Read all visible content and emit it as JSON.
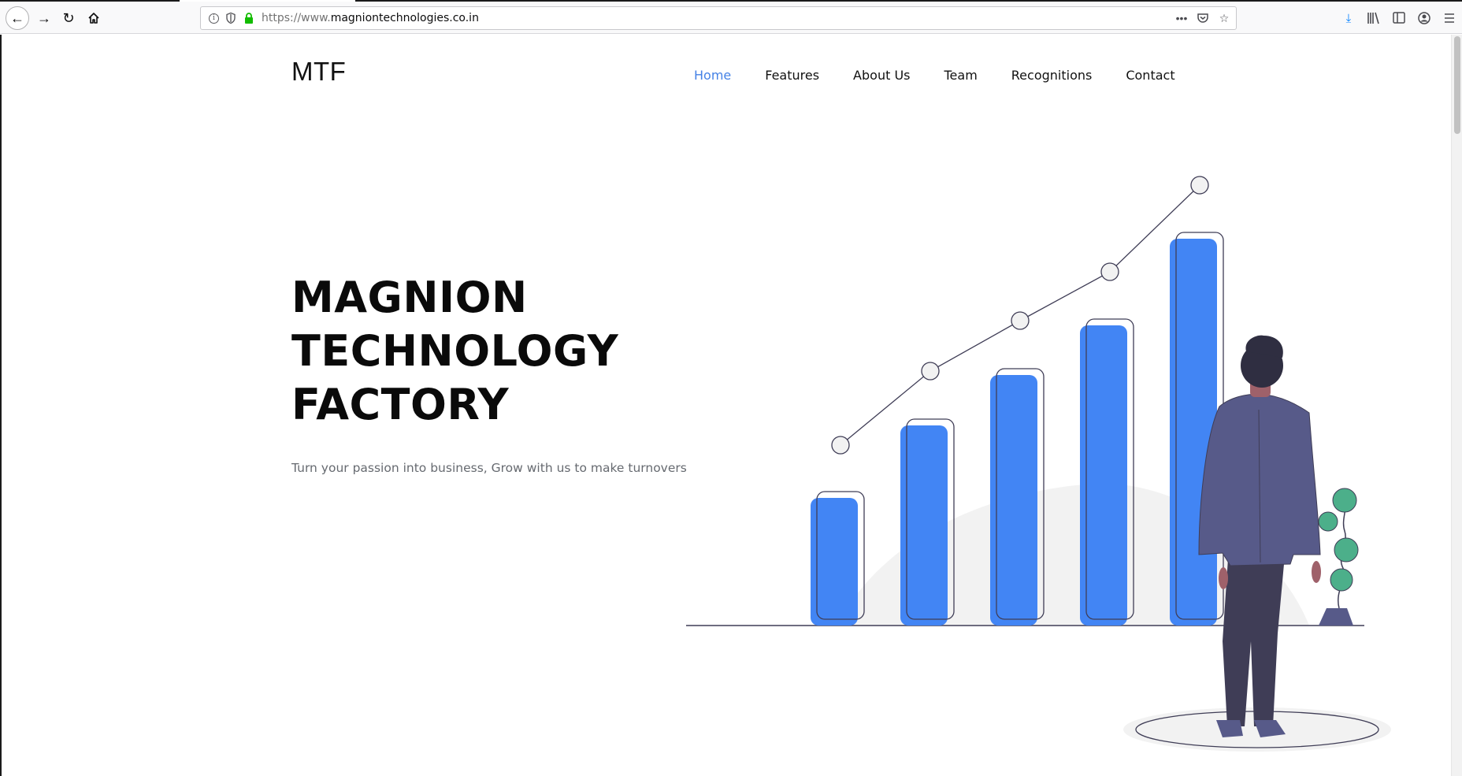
{
  "browser": {
    "url_prefix": "https://www.",
    "url_domain": "magniontechnologies.co.in",
    "icons": {
      "back": "arrow-left-icon",
      "forward": "arrow-right-icon",
      "reload": "reload-icon",
      "home": "home-icon",
      "more": "more-dots-icon",
      "pocket": "pocket-icon",
      "bookmark": "star-icon",
      "download": "download-icon",
      "library": "library-icon",
      "sidebar": "sidebar-icon",
      "account": "account-icon",
      "menu": "hamburger-menu-icon"
    }
  },
  "site": {
    "logo": "MTF",
    "nav": [
      {
        "label": "Home",
        "active": true
      },
      {
        "label": "Features",
        "active": false
      },
      {
        "label": "About Us",
        "active": false
      },
      {
        "label": "Team",
        "active": false
      },
      {
        "label": "Recognitions",
        "active": false
      },
      {
        "label": "Contact",
        "active": false
      }
    ],
    "hero": {
      "title_lines": [
        "MAGNION",
        "TECHNOLOGY",
        "FACTORY"
      ],
      "subtitle": "Turn your passion into business, Grow with us to make turnovers"
    },
    "colors": {
      "accent": "#4582e6",
      "bar": "#4285f4",
      "suit": "#575a89",
      "pants": "#3f3d56",
      "leaf": "#4caf8a"
    }
  }
}
